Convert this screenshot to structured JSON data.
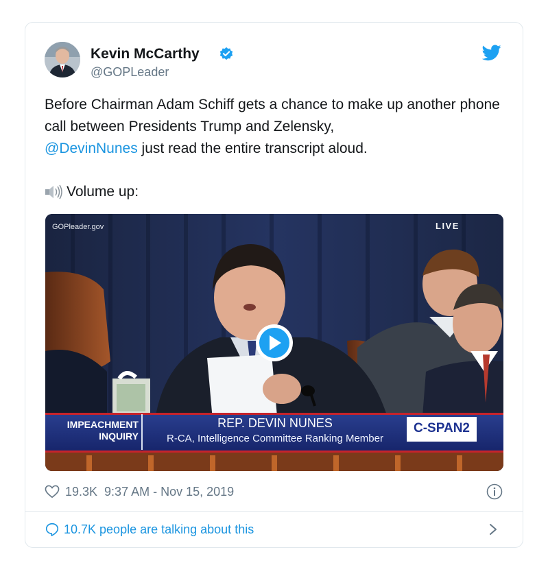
{
  "tweet": {
    "author_name": "Kevin McCarthy",
    "author_handle": "@GOPLeader",
    "text_before_mention": "Before Chairman Adam Schiff gets a chance to make up another phone call between Presidents Trump and Zelensky,",
    "mention": "@DevinNunes",
    "text_after_mention": " just read the entire transcript aloud.",
    "volume_text": "Volume up:",
    "likes": "19.3K",
    "timestamp": "9:37 AM - Nov 15, 2019",
    "talking": "10.7K people are talking about this"
  },
  "video": {
    "source": "GOPleader.gov",
    "live": "LIVE",
    "lower_third_tag_line1": "IMPEACHMENT",
    "lower_third_tag_line2": "INQUIRY",
    "lower_third_name": "REP. DEVIN NUNES",
    "lower_third_title": "R-CA, Intelligence Committee Ranking Member",
    "network_logo": "C-SPAN2"
  },
  "icons": {
    "verified": "verified-badge-icon",
    "bird": "twitter-bird-icon",
    "speaker": "speaker-volume-icon",
    "play": "play-icon",
    "heart": "heart-icon",
    "info": "info-icon",
    "bubble": "speech-bubble-icon",
    "chevron": "chevron-right-icon"
  },
  "colors": {
    "link": "#1b95e0",
    "muted": "#657786",
    "text": "#14171a",
    "border": "#e1e8ed"
  }
}
